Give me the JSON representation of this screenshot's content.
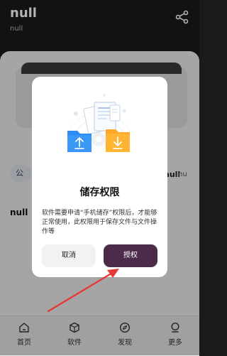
{
  "header": {
    "title": "null",
    "subtitle": "null"
  },
  "background": {
    "pill_label": "公",
    "row_right_label_a": "null",
    "row_right_label_b": "nu",
    "section_label": "null"
  },
  "nav": {
    "items": [
      {
        "label": "首页",
        "icon": "home-icon"
      },
      {
        "label": "软件",
        "icon": "box-icon"
      },
      {
        "label": "发现",
        "icon": "compass-icon"
      },
      {
        "label": "更多",
        "icon": "more-icon"
      }
    ]
  },
  "dialog": {
    "title": "储存权限",
    "message": "软件需要申请“手机储存”权限后，才能够正常使用，此权限用于保存文件与文件操作等",
    "cancel_label": "取消",
    "authorize_label": "授权"
  },
  "colors": {
    "header_bg": "#1b1b1b",
    "accent": "#4c2b4a",
    "arrow": "#e53935",
    "folder_blue": "#2f8cf0",
    "folder_orange": "#ffb533"
  }
}
